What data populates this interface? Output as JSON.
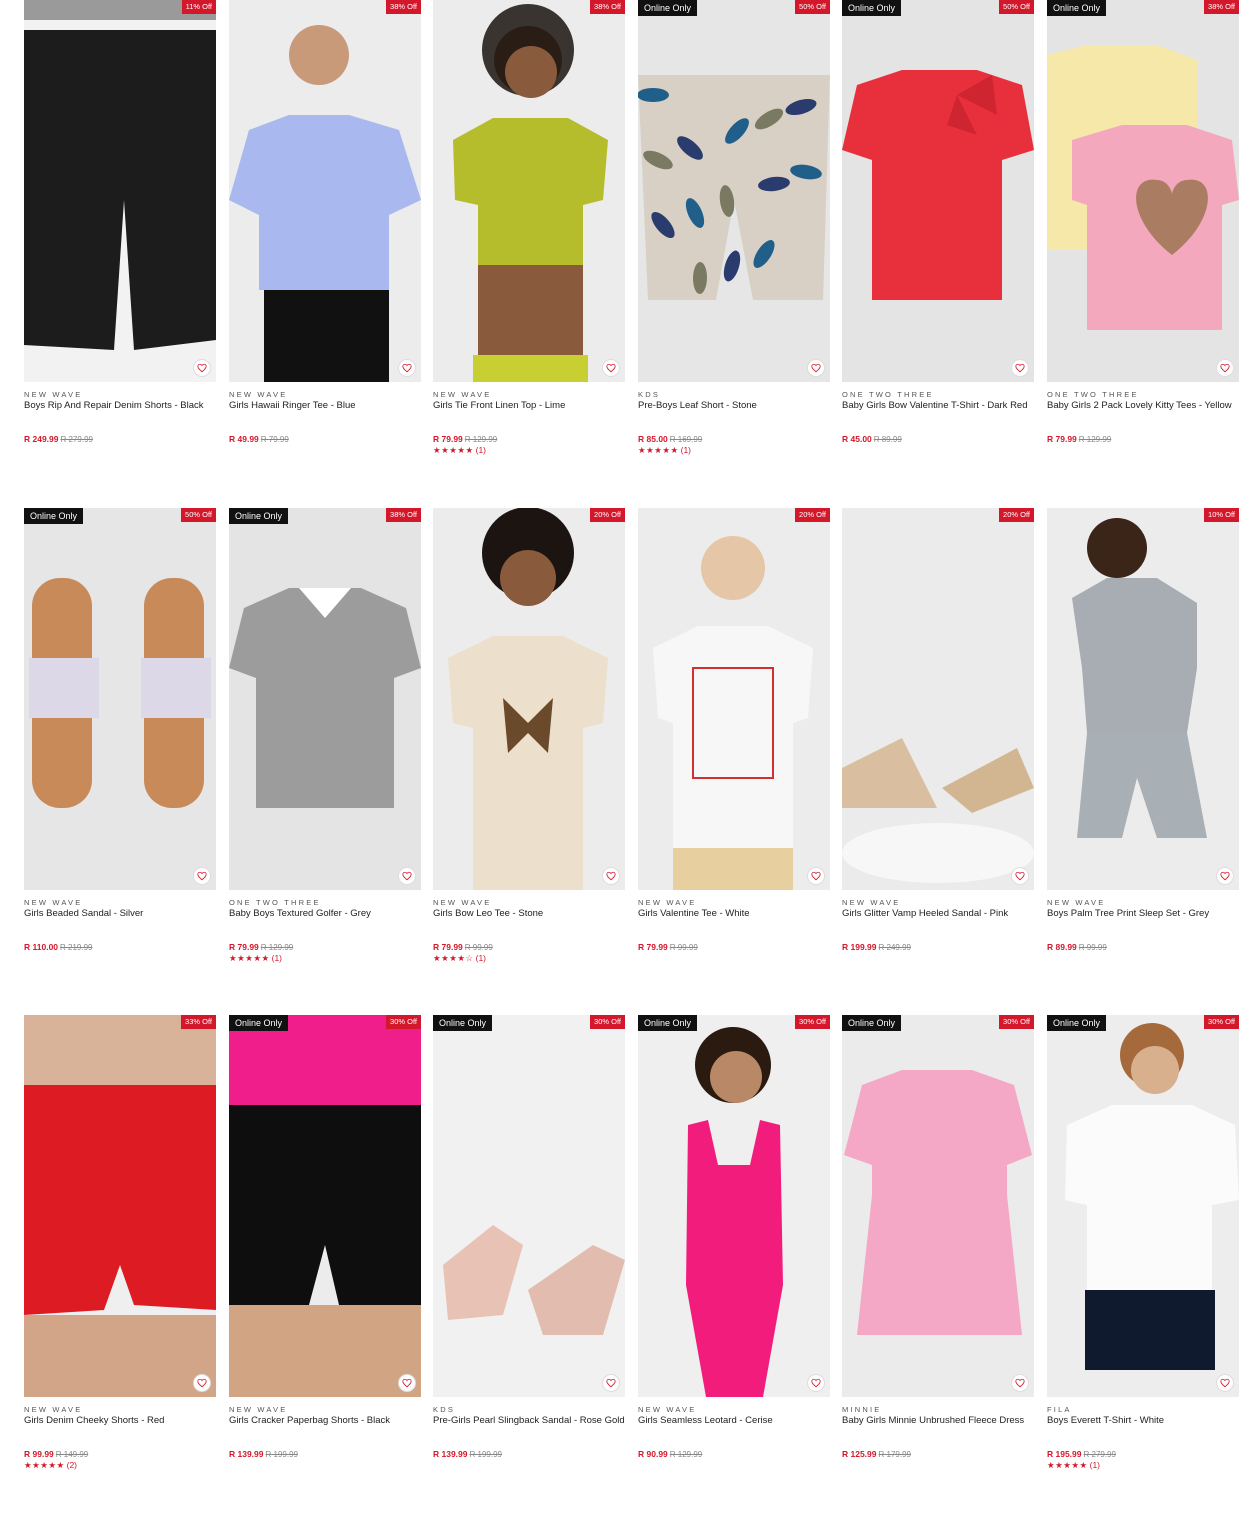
{
  "products": [
    {
      "brand": "NEW WAVE",
      "name": "Boys Rip And Repair Denim Shorts - Black",
      "price": "R 249.99",
      "was": "R 279.99",
      "discount": "11% Off",
      "online": "",
      "stars": "",
      "reviews": "",
      "bg": "#f2f2f2"
    },
    {
      "brand": "NEW WAVE",
      "name": "Girls Hawaii Ringer Tee - Blue",
      "price": "R 49.99",
      "was": "R 79.99",
      "discount": "38% Off",
      "online": "",
      "stars": "",
      "reviews": "",
      "bg": "#ececec"
    },
    {
      "brand": "NEW WAVE",
      "name": "Girls Tie Front Linen Top - Lime",
      "price": "R 79.99",
      "was": "R 129.99",
      "discount": "38% Off",
      "online": "",
      "stars": "★★★★★",
      "reviews": "(1)",
      "bg": "#ececec"
    },
    {
      "brand": "KDS",
      "name": "Pre-Boys Leaf Short - Stone",
      "price": "R 85.00",
      "was": "R 169.99",
      "discount": "50% Off",
      "online": "Online Only",
      "stars": "★★★★★",
      "reviews": "(1)",
      "bg": "#e6e6e6"
    },
    {
      "brand": "ONE TWO THREE",
      "name": "Baby Girls Bow Valentine T-Shirt - Dark Red",
      "price": "R 45.00",
      "was": "R 89.99",
      "discount": "50% Off",
      "online": "Online Only",
      "stars": "",
      "reviews": "",
      "bg": "#e4e4e4"
    },
    {
      "brand": "ONE TWO THREE",
      "name": "Baby Girls 2 Pack Lovely Kitty Tees - Yellow",
      "price": "R 79.99",
      "was": "R 129.99",
      "discount": "38% Off",
      "online": "Online Only",
      "stars": "",
      "reviews": "",
      "bg": "#e4e4e4"
    },
    {
      "brand": "NEW WAVE",
      "name": "Girls Beaded Sandal - Silver",
      "price": "R 110.00",
      "was": "R 219.99",
      "discount": "50% Off",
      "online": "Online Only",
      "stars": "",
      "reviews": "",
      "bg": "#e6e6e6"
    },
    {
      "brand": "ONE TWO THREE",
      "name": "Baby Boys Textured Golfer - Grey",
      "price": "R 79.99",
      "was": "R 129.99",
      "discount": "38% Off",
      "online": "Online Only",
      "stars": "★★★★★",
      "reviews": "(1)",
      "bg": "#e4e4e4"
    },
    {
      "brand": "NEW WAVE",
      "name": "Girls Bow Leo Tee - Stone",
      "price": "R 79.99",
      "was": "R 99.99",
      "discount": "20% Off",
      "online": "",
      "stars": "★★★★☆",
      "reviews": "(1)",
      "bg": "#ececec"
    },
    {
      "brand": "NEW WAVE",
      "name": "Girls Valentine Tee - White",
      "price": "R 79.99",
      "was": "R 99.99",
      "discount": "20% Off",
      "online": "",
      "stars": "",
      "reviews": "",
      "bg": "#ececec"
    },
    {
      "brand": "NEW WAVE",
      "name": "Girls Glitter Vamp Heeled Sandal - Pink",
      "price": "R 199.99",
      "was": "R 249.99",
      "discount": "20% Off",
      "online": "",
      "stars": "",
      "reviews": "",
      "bg": "#ebebeb"
    },
    {
      "brand": "NEW WAVE",
      "name": "Boys Palm Tree Print Sleep Set - Grey",
      "price": "R 89.99",
      "was": "R 99.99",
      "discount": "10% Off",
      "online": "",
      "stars": "",
      "reviews": "",
      "bg": "#ececec"
    },
    {
      "brand": "NEW WAVE",
      "name": "Girls Denim Cheeky Shorts - Red",
      "price": "R 99.99",
      "was": "R 149.99",
      "discount": "33% Off",
      "online": "",
      "stars": "★★★★★",
      "reviews": "(2)",
      "bg": "#efefef"
    },
    {
      "brand": "NEW WAVE",
      "name": "Girls Cracker Paperbag Shorts - Black",
      "price": "R 139.99",
      "was": "R 199.99",
      "discount": "30% Off",
      "online": "Online Only",
      "stars": "",
      "reviews": "",
      "bg": "#ececec"
    },
    {
      "brand": "KDS",
      "name": "Pre-Girls Pearl Slingback Sandal - Rose Gold",
      "price": "R 139.99",
      "was": "R 199.99",
      "discount": "30% Off",
      "online": "Online Only",
      "stars": "",
      "reviews": "",
      "bg": "#f1f1f1"
    },
    {
      "brand": "NEW WAVE",
      "name": "Girls Seamless Leotard - Cerise",
      "price": "R 90.99",
      "was": "R 129.99",
      "discount": "30% Off",
      "online": "Online Only",
      "stars": "",
      "reviews": "",
      "bg": "#efefef"
    },
    {
      "brand": "MINNIE",
      "name": "Baby Girls Minnie Unbrushed Fleece Dress",
      "price": "R 125.99",
      "was": "R 179.99",
      "discount": "30% Off",
      "online": "Online Only",
      "stars": "",
      "reviews": "",
      "bg": "#ebebeb"
    },
    {
      "brand": "FILA",
      "name": "Boys Everett T-Shirt - White",
      "price": "R 195.99",
      "was": "R 279.99",
      "discount": "30% Off",
      "online": "Online Only",
      "stars": "★★★★★",
      "reviews": "(1)",
      "bg": "#ededed"
    }
  ],
  "icons": {
    "wishlist": "heart-icon",
    "rating": "star-icon"
  },
  "colors": {
    "accent": "#d4182b",
    "online_badge": "#111111"
  }
}
